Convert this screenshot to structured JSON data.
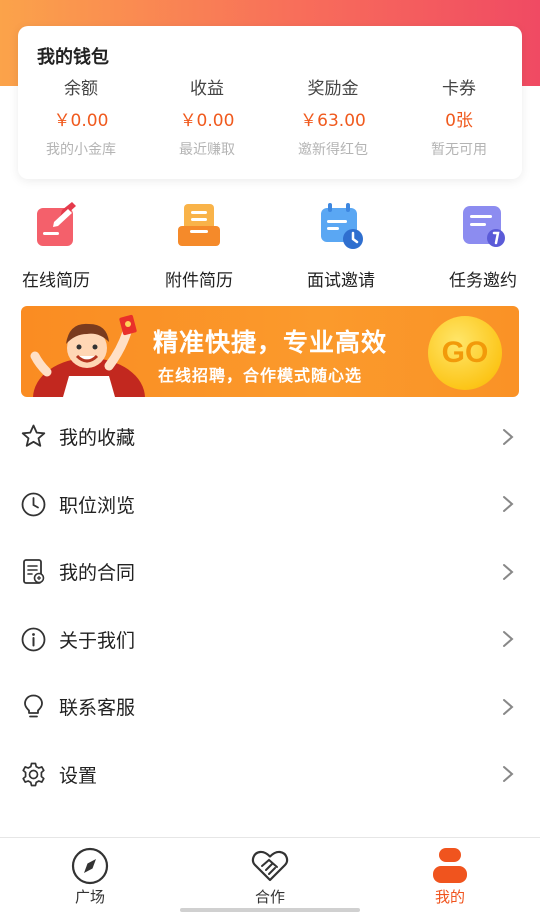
{
  "wallet": {
    "title": "我的钱包",
    "columns": [
      {
        "label": "余额",
        "value": "￥0.00",
        "sub": "我的小金库"
      },
      {
        "label": "收益",
        "value": "￥0.00",
        "sub": "最近赚取"
      },
      {
        "label": "奖励金",
        "value": "￥63.00",
        "sub": "邀新得红包"
      },
      {
        "label": "卡券",
        "value": "0张",
        "sub": "暂无可用"
      }
    ]
  },
  "features": [
    {
      "label": "在线简历",
      "icon": "online-resume-icon"
    },
    {
      "label": "附件简历",
      "icon": "attachment-resume-icon"
    },
    {
      "label": "面试邀请",
      "icon": "interview-invite-icon"
    },
    {
      "label": "任务邀约",
      "icon": "task-invite-icon"
    }
  ],
  "banner": {
    "headline": "精准快捷，专业高效",
    "subline": "在线招聘，合作模式随心选",
    "go_label": "GO"
  },
  "menu": [
    {
      "label": "我的收藏",
      "icon": "star-icon"
    },
    {
      "label": "职位浏览",
      "icon": "clock-icon"
    },
    {
      "label": "我的合同",
      "icon": "contract-icon"
    },
    {
      "label": "关于我们",
      "icon": "info-icon"
    },
    {
      "label": "联系客服",
      "icon": "lightbulb-icon"
    },
    {
      "label": "设置",
      "icon": "gear-icon"
    }
  ],
  "tabs": [
    {
      "label": "广场",
      "icon": "compass-icon",
      "active": false
    },
    {
      "label": "合作",
      "icon": "handshake-icon",
      "active": false
    },
    {
      "label": "我的",
      "icon": "profile-icon",
      "active": true
    }
  ],
  "colors": {
    "accent": "#f0541e",
    "gradient_start": "#fba34a",
    "gradient_end": "#f04a63",
    "banner": "#fa8c22"
  }
}
